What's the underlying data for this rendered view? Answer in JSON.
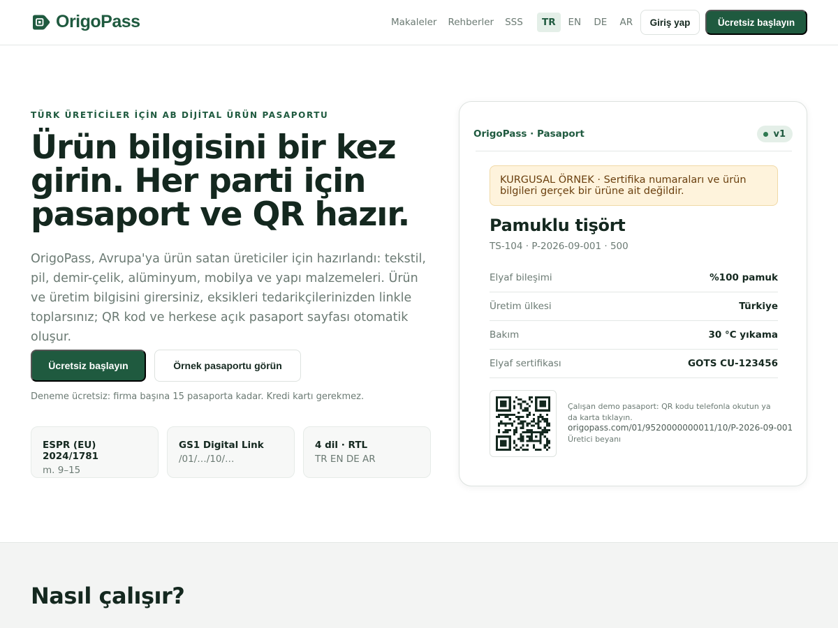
{
  "header": {
    "brand": "OrigoPass",
    "nav": [
      "Makaleler",
      "Rehberler",
      "SSS"
    ],
    "languages": [
      "TR",
      "EN",
      "DE",
      "AR"
    ],
    "active_language": "TR",
    "login_label": "Giriş yap",
    "start_label": "Ücretsiz başlayın"
  },
  "hero": {
    "eyebrow": "TÜRK ÜRETİCİLER İÇİN AB DİJİTAL ÜRÜN PASAPORTU",
    "title_lines": [
      "Ürün bilgisini bir kez",
      "girin. Her parti için",
      "pasaport ve QR hazır."
    ],
    "description": "OrigoPass, Avrupa'ya ürün satan üreticiler için hazırlandı: tekstil, pil, demir-çelik, alüminyum, mobilya ve yapı malzemeleri. Ürün ve üretim bilgisini girersiniz, eksikleri tedarikçilerinizden linkle toplarsınız; QR kod ve herkese açık pasaport sayfası otomatik oluşur.",
    "cta_primary": "Ücretsiz başlayın",
    "cta_secondary": "Örnek pasaportu görün",
    "note": "Deneme ücretsiz: firma başına 15 pasaporta kadar. Kredi kartı gerekmez.",
    "features": [
      {
        "title": "ESPR (EU) 2024/1781",
        "sub": "m. 9–15"
      },
      {
        "title": "GS1 Digital Link",
        "sub": "/01/…/10/…"
      },
      {
        "title": "4 dil · RTL",
        "sub": "TR EN DE AR"
      }
    ]
  },
  "passport": {
    "brand": "OrigoPass · Pasaport",
    "version": "v1",
    "notice": "KURGUSAL ÖRNEK · Sertifika numaraları ve ürün bilgileri gerçek bir ürüne ait değildir.",
    "product_name": "Pamuklu tişört",
    "product_meta": "TS-104 · P-2026-09-001 · 500",
    "specs": [
      {
        "label": "Elyaf bileşimi",
        "value": "%100 pamuk"
      },
      {
        "label": "Üretim ülkesi",
        "value": "Türkiye"
      },
      {
        "label": "Bakım",
        "value": "30 °C yıkama"
      },
      {
        "label": "Elyaf sertifikası",
        "value": "GOTS CU-123456"
      }
    ],
    "qr_caption": "Çalışan demo pasaport: QR kodu telefonla okutun ya da karta tıklayın.",
    "qr_url": "origopass.com/01/9520000000011/10/P-2026-09-001",
    "qr_declaration": "Üretici beyanı"
  },
  "section": {
    "title": "Nasıl çalışır?"
  },
  "colors": {
    "brand_green": "#1f5a3f",
    "notice_bg": "#fef3dc",
    "text_dark": "#14281f",
    "text_muted": "#6b7a73"
  }
}
